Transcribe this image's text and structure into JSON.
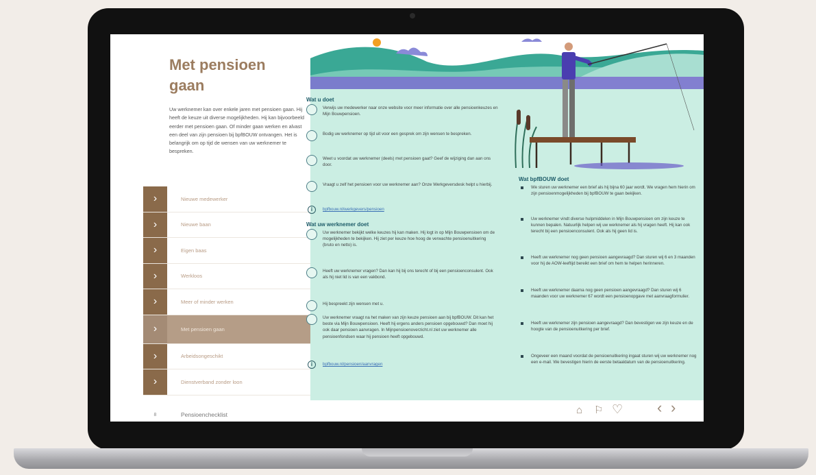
{
  "page": {
    "title": "Met pensioen gaan",
    "intro": "Uw werknemer kan over enkele jaren met pensioen gaan. Hij heeft de keuze uit diverse mogelijkheden. Hij kan bijvoorbeeld eerder met pensioen gaan. Of minder gaan werken en alvast een deel van zijn pensioen bij bpfBOUW ontvangen. Het is belangrijk om op tijd de wensen van uw werknemer te bespreken."
  },
  "nav": {
    "items": [
      {
        "label": "Nieuwe medewerker"
      },
      {
        "label": "Nieuwe baan"
      },
      {
        "label": "Eigen baas"
      },
      {
        "label": "Werkloos"
      },
      {
        "label": "Meer of minder werken"
      },
      {
        "label": "Met pensioen gaan"
      },
      {
        "label": "Arbeidsongeschikt"
      },
      {
        "label": "Dienstverband zonder loon"
      }
    ],
    "footer": {
      "num": "8",
      "label": "Pensioenchecklist"
    }
  },
  "wat_u_doet": {
    "title": "Wat u doet",
    "steps": [
      "Verwijs uw medewerker naar onze website voor meer informatie over alle pensioenkeuzes en Mijn Bouwpensioen.",
      "Bodig uw werknemer op tijd uit voor een gesprek om zijn wensen te bespreken.",
      "Weet u voordat uw werknemer (deels) met pensioen gaat? Geef de wijziging dan aan ons door.",
      "Vraagt u zelf het pensioen voor uw werknemer aan? Onze Werkgeversdesk helpt u hierbij."
    ],
    "link": "bpfbouw.nl/werkgevers/pensioen"
  },
  "wat_werknemer_doet": {
    "title": "Wat uw werknemer doet",
    "steps": [
      "Uw werknemer bekijkt welke keuzes hij kan maken. Hij logt in op Mijn Bouwpensioen om de mogelijkheden te bekijken. Hij ziet per keuze hoe hoog de verwachte pensioenuitkering (bruto en netto) is.",
      "Heeft uw werknemer vragen? Dan kan hij bij ons terecht of bij een pensioenconsulent. Ook als hij niet lid is van een vakbond.",
      "Hij bespreekt zijn wensen met u.",
      "Uw werknemer vraagt na het maken van zijn keuze pensioen aan bij bpfBOUW. Dit kan het beste via Mijn Bouwpensioen. Heeft hij ergens anders pensioen opgebouwd? Dan moet hij ook daar pensioen aanvragen. In Mijnpensioenoverzicht.nl ziet uw werknemer alle pensioenfondsen waar hij pensioen heeft opgebouwd."
    ],
    "link": "bpfbouw.nl/pensioen/aanvragen"
  },
  "bpfbouw_doet": {
    "title": "Wat bpfBOUW doet",
    "bullets": [
      "We sturen uw werknemer een brief als hij bijna 60 jaar wordt. We vragen hem hierin om zijn pensioenmogelijkheden bij bpfBOUW te gaan bekijken.",
      "Uw werknemer vindt diverse hulpmiddelen in Mijn Bouwpensioen om zijn keuze te kunnen bepalen. Natuurlijk helpen wij uw werknemer als hij vragen heeft. Hij kan ook terecht bij een pensioenconsulent. Ook als hij geen lid is.",
      "Heeft uw werknemer nog geen pensioen aangevraagd? Dan sturen wij 6 en 3 maanden voor hij de AOW-leeftijd bereikt een brief om hem te helpen herinneren.",
      "Heeft uw werknemer daarna nog geen pensioen aangevraagd? Dan sturen wij 6 maanden voor uw werknemer 67 wordt een pensioenopgave met aanvraagformulier.",
      "Heeft uw werknemer zijn pensioen aangevraagd? Dan bevestigen we zijn keuze en de hoogte van de pensioenuitkering per brief.",
      "Ongeveer een maand voordat de pensioenuitkering ingaat sturen wij uw werknemer nog een e-mail. We bevestigen hierin de eerste betaaldatum van de pensioenuitkering."
    ]
  },
  "toolbar": {
    "icons": [
      "home-icon",
      "signpost-icon",
      "heart-icon",
      "chevron-left-icon",
      "chevron-right-icon"
    ],
    "home": "⌂",
    "signpost": "⚐",
    "heart": "♡",
    "prev": "‹",
    "next": "›"
  },
  "colors": {
    "brown_dark": "#8a6a4a",
    "brown_active": "#b59d87",
    "title_brown": "#9b7c5f",
    "mint_bg": "#cbeee3",
    "teal_text": "#1d5b68"
  }
}
